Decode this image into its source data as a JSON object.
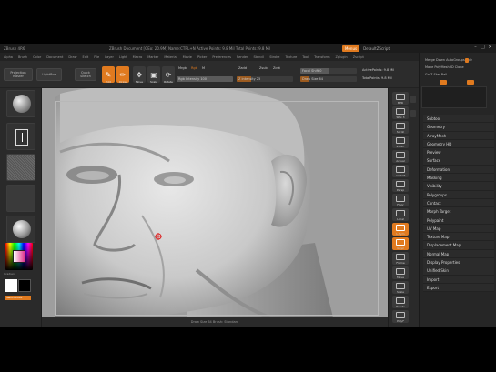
{
  "titlebar": {
    "app": "ZBrush 4R6",
    "center": "ZBrush Document   [GEo: 20.9M]  Name:CTRL+N  Active Points: 9.8 Mil   Total Points: 9.8 Mil",
    "menus": "Menus",
    "default_script": "DefaultZScript",
    "controls": [
      "–",
      "□",
      "×"
    ]
  },
  "menubar": [
    "Alpha",
    "Brush",
    "Color",
    "Document",
    "Draw",
    "Edit",
    "File",
    "Layer",
    "Light",
    "Macro",
    "Marker",
    "Material",
    "Movie",
    "Picker",
    "Preferences",
    "Render",
    "Stencil",
    "Stroke",
    "Texture",
    "Tool",
    "Transform",
    "Zplugin",
    "Zscript"
  ],
  "toolbar": {
    "projection_master": "Projection Master",
    "lightbox": "LightBox",
    "quick_sketch": "Quick Sketch",
    "edit": "Edit",
    "draw": "Draw",
    "move": "Move",
    "scale": "Scale",
    "rotate": "Rotate",
    "mrgb": "Mrgb",
    "rgb": "Rgb",
    "m": "M",
    "zadd": "Zadd",
    "zsub": "Zsub",
    "zcut": "Zcut",
    "rgb_intensity": "Rgb Intensity 100",
    "z_intensity": "Z Intensity 25",
    "focal_shift": "Focal Shift 0",
    "draw_size": "Draw Size 64",
    "dynamic": "Dynamic",
    "active_points": "ActivePoints: 9.8 Mil",
    "total_points": "TotalPoints: 9.8 Mil"
  },
  "leftshelf": {
    "labels": [
      "Standard",
      "Dots",
      "Alpha Off",
      "Texture Off",
      "MatCap Gray",
      "Gradient",
      "SwitchColor"
    ]
  },
  "rightshelf": {
    "buttons": [
      "BPR",
      "SPix 3",
      "Scroll",
      "Zoom",
      "Actual",
      "AAHalf",
      "Persp",
      "Floor",
      "Local",
      "L.Sym",
      "Gxyz",
      "Frame",
      "Move",
      "Scale",
      "Rotate",
      "PolyF",
      "Transp",
      "Ghost",
      "Solo",
      "Xpose"
    ]
  },
  "tray": {
    "top": {
      "line1": "Merge Down   AutoGroups   Poly",
      "line2": "Make PolyMesh3D  Clone",
      "line3": "Go Z  Star  Ball"
    },
    "items": [
      "Subtool",
      "Geometry",
      "ArrayMesh",
      "Geometry HD",
      "Preview",
      "Surface",
      "Deformation",
      "Masking",
      "Visibility",
      "Polygroups",
      "Contact",
      "Morph Target",
      "Polypaint",
      "UV Map",
      "Texture Map",
      "Displacement Map",
      "Normal Map",
      "Display Properties",
      "Unified Skin",
      "Import",
      "Export"
    ]
  },
  "statusbar": "Draw Size 64   Brush: Standard"
}
